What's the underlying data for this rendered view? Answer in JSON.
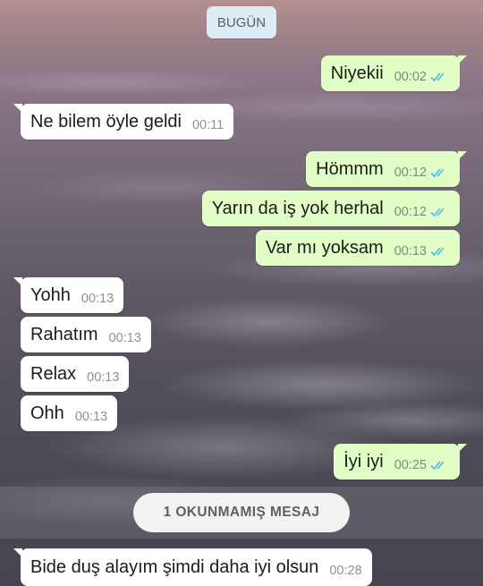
{
  "day_separator": "BUGÜN",
  "messages": [
    {
      "dir": "out",
      "text": "Niyekii",
      "time": "00:02",
      "read": true
    },
    {
      "dir": "in",
      "text": "Ne bilem öyle geldi",
      "time": "00:11"
    },
    {
      "dir": "out",
      "text": "Hömmm",
      "time": "00:12",
      "read": true
    },
    {
      "dir": "out",
      "text": "Yarın da iş yok herhal",
      "time": "00:12",
      "read": true
    },
    {
      "dir": "out",
      "text": "Var mı yoksam",
      "time": "00:13",
      "read": true
    },
    {
      "dir": "in",
      "text": "Yohh",
      "time": "00:13"
    },
    {
      "dir": "in",
      "text": "Rahatım",
      "time": "00:13"
    },
    {
      "dir": "in",
      "text": "Relax",
      "time": "00:13"
    },
    {
      "dir": "in",
      "text": "Ohh",
      "time": "00:13"
    },
    {
      "dir": "out",
      "text": "İyi iyi",
      "time": "00:25",
      "read": true
    },
    {
      "dir": "in",
      "text": "Bide duş alayım şimdi daha iyi olsun",
      "time": "00:28"
    }
  ],
  "unread_banner": "1 OKUNMAMIŞ MESAJ",
  "icons": {
    "read_receipt": "double-check-icon"
  },
  "colors": {
    "outgoing_bubble": "#e1fec6",
    "incoming_bubble": "#ffffff",
    "read_tick": "#4fb6ec"
  }
}
